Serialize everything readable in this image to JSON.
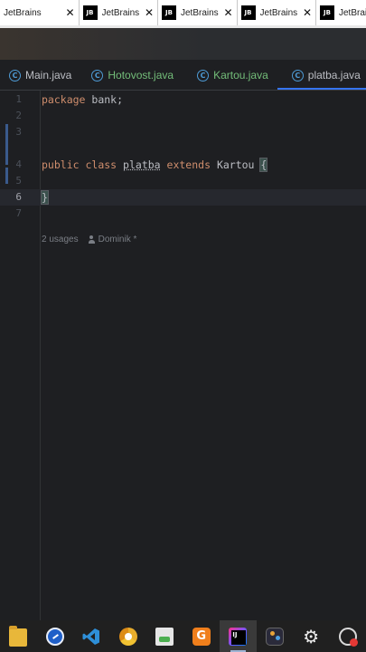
{
  "browser_tabs": [
    {
      "title": "JetBrains",
      "has_logo": false
    },
    {
      "title": "JetBrains",
      "has_logo": true
    },
    {
      "title": "JetBrains",
      "has_logo": true
    },
    {
      "title": "JetBrains",
      "has_logo": true
    },
    {
      "title": "JetBrains",
      "has_logo": true
    }
  ],
  "browser": {
    "logo_text": "JB",
    "close_glyph": "✕"
  },
  "editor_tabs": [
    {
      "label": "Main.java",
      "color": "#bcbec4",
      "active": false
    },
    {
      "label": "Hotovost.java",
      "color": "#73bd79",
      "active": false
    },
    {
      "label": "Kartou.java",
      "color": "#73bd79",
      "active": false
    },
    {
      "label": "platba.java",
      "color": "#bcbec4",
      "active": true
    }
  ],
  "editor": {
    "tab_icon_glyph": "C",
    "line_numbers": [
      "1",
      "2",
      "3",
      "4",
      "5",
      "6",
      "7"
    ],
    "current_line": "6",
    "code": {
      "line1_kw": "package",
      "line1_rest": " bank;",
      "line4_kw1": "public",
      "line4_kw2": "class",
      "line4_name": "platba",
      "line4_kw3": "extends",
      "line4_parent": "Kartou",
      "line4_brace": "{",
      "line6_brace": "}"
    },
    "inlay_hint": {
      "usages": "2 usages",
      "author": "Dominik *"
    }
  },
  "taskbar": {
    "items": [
      "file-explorer",
      "blue-s-app",
      "vscode",
      "browser",
      "notepad",
      "orange-app",
      "intellij",
      "davinci-resolve",
      "settings",
      "monitor-app"
    ],
    "active": "intellij",
    "orange_glyph": "G",
    "gear_glyph": "⚙"
  },
  "colors": {
    "editor_bg": "#1e1f22",
    "keyword": "#cf8e6d",
    "text": "#bcbec4",
    "accent": "#3574f0",
    "line_number": "#4b5059"
  }
}
